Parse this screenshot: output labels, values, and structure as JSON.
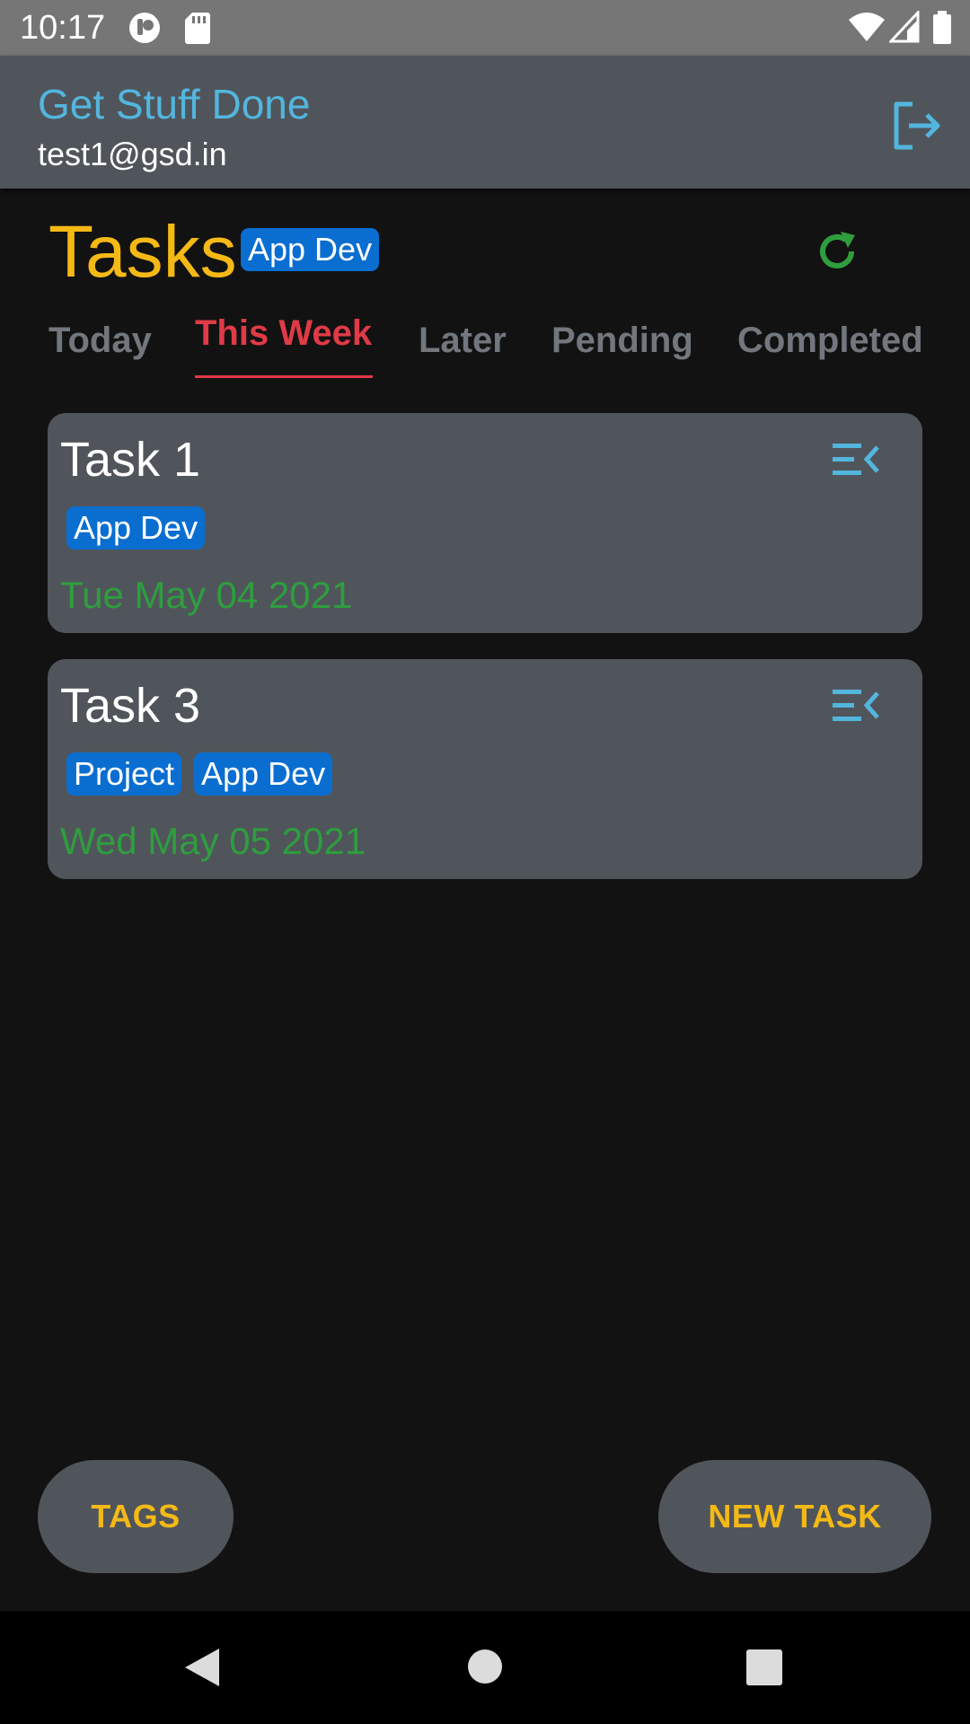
{
  "status_bar": {
    "time": "10:17"
  },
  "app_bar": {
    "title": "Get Stuff Done",
    "email": "test1@gsd.in"
  },
  "page": {
    "heading": "Tasks",
    "filter_tag": "App Dev"
  },
  "tabs": [
    {
      "label": "Today",
      "active": false
    },
    {
      "label": "This Week",
      "active": true
    },
    {
      "label": "Later",
      "active": false
    },
    {
      "label": "Pending",
      "active": false
    },
    {
      "label": "Completed",
      "active": false
    }
  ],
  "tasks": [
    {
      "title": "Task 1",
      "tags": [
        "App Dev"
      ],
      "date": "Tue May 04 2021"
    },
    {
      "title": "Task 3",
      "tags": [
        "Project",
        "App Dev"
      ],
      "date": "Wed May 05 2021"
    }
  ],
  "actions": {
    "tags_label": "TAGS",
    "new_task_label": "NEW TASK"
  },
  "icons": {
    "logout": "logout-icon",
    "refresh": "refresh-icon",
    "task_menu": "menu-collapse-icon",
    "back": "back-icon",
    "home": "home-icon",
    "recents": "recents-icon"
  },
  "colors": {
    "background": "#121212",
    "surface": "#50555b",
    "accent_yellow": "#f5b915",
    "accent_blue": "#52b6de",
    "tag_blue": "#0a6ed1",
    "active_tab_red": "#e03a47",
    "date_green": "#2e9e3e",
    "refresh_green": "#2e9e3e",
    "inactive_tab": "#72777d"
  }
}
